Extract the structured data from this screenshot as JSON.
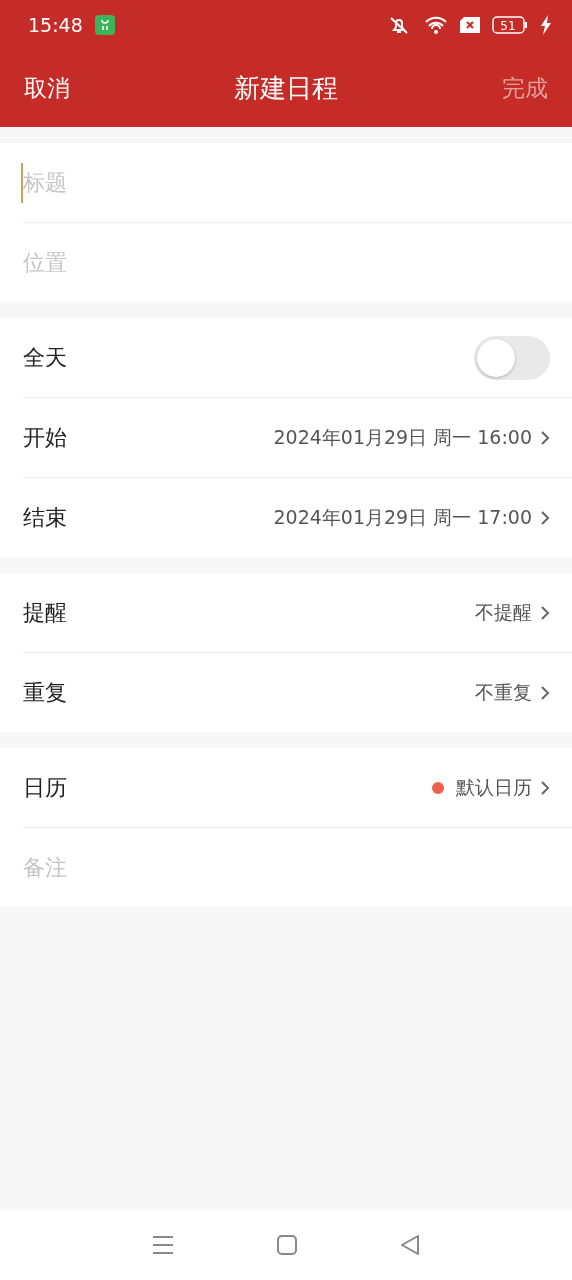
{
  "status_bar": {
    "time": "15:48",
    "battery": "51"
  },
  "header": {
    "cancel": "取消",
    "title": "新建日程",
    "done": "完成",
    "done_disabled": true
  },
  "groups": [
    {
      "rows": [
        {
          "kind": "field",
          "placeholder": "标题",
          "focused": true
        },
        {
          "kind": "field",
          "placeholder": "位置",
          "focused": false
        }
      ]
    },
    {
      "rows": [
        {
          "kind": "toggle",
          "label": "全天",
          "on": false
        },
        {
          "kind": "value",
          "label": "开始",
          "value": "2024年01月29日 周一 16:00"
        },
        {
          "kind": "value",
          "label": "结束",
          "value": "2024年01月29日 周一 17:00"
        }
      ]
    },
    {
      "rows": [
        {
          "kind": "value",
          "label": "提醒",
          "value": "不提醒"
        },
        {
          "kind": "value",
          "label": "重复",
          "value": "不重复"
        }
      ]
    },
    {
      "rows": [
        {
          "kind": "value",
          "label": "日历",
          "value": "默认日历",
          "color": "#f0604d"
        },
        {
          "kind": "field",
          "placeholder": "备注",
          "focused": false
        }
      ]
    }
  ]
}
